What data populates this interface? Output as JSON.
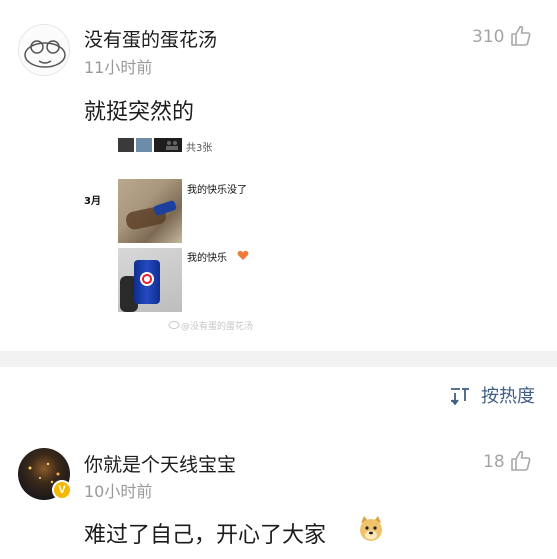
{
  "comments": [
    {
      "username": "没有蛋的蛋花汤",
      "time": "11小时前",
      "likes": "310",
      "text": "就挺突然的",
      "embedded": {
        "count_label": "共3张",
        "month": "3月",
        "caption1": "我的快乐没了",
        "caption2": "我的快乐",
        "watermark": "@没有蛋的蛋花汤"
      }
    },
    {
      "username": "你就是个天线宝宝",
      "time": "10小时前",
      "likes": "18",
      "text": "难过了自己，开心了大家",
      "verified_badge": "V"
    }
  ],
  "sort": {
    "label": "按热度",
    "icon": "sort-icon"
  },
  "colors": {
    "link": "#3f5f86",
    "meta": "#9a9a9a",
    "divider": "#f2f2f2",
    "badge": "#f5b800"
  }
}
